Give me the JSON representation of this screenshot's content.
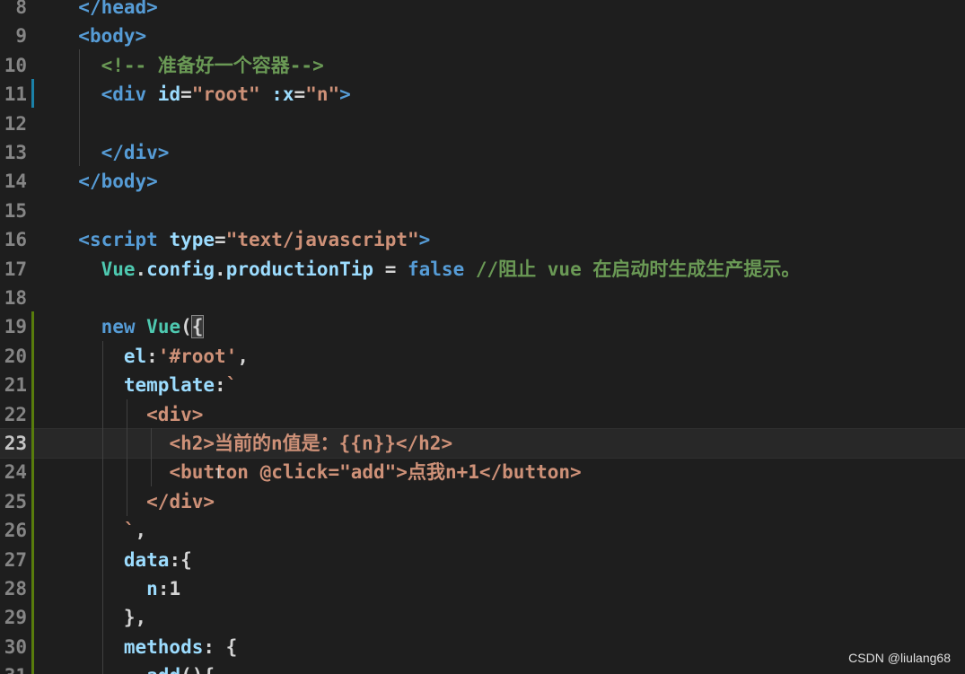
{
  "editor": {
    "language": "html",
    "current_line": "23",
    "lines": [
      {
        "n": "8",
        "parts": [
          {
            "t": "  ",
            "c": "punct"
          },
          {
            "t": "</head>",
            "c": "tag"
          }
        ]
      },
      {
        "n": "9",
        "parts": [
          {
            "t": "  ",
            "c": "punct"
          },
          {
            "t": "<body>",
            "c": "tag"
          }
        ]
      },
      {
        "n": "10",
        "parts": [
          {
            "t": "    ",
            "c": "punct"
          },
          {
            "t": "<!-- 准备好一个容器-->",
            "c": "cmt"
          }
        ]
      },
      {
        "n": "11",
        "parts": [
          {
            "t": "    ",
            "c": "punct"
          },
          {
            "t": "<div",
            "c": "tag"
          },
          {
            "t": " id",
            "c": "attr"
          },
          {
            "t": "=",
            "c": "punct"
          },
          {
            "t": "\"root\"",
            "c": "str"
          },
          {
            "t": " :x",
            "c": "attr"
          },
          {
            "t": "=",
            "c": "punct"
          },
          {
            "t": "\"n\"",
            "c": "str"
          },
          {
            "t": ">",
            "c": "tag"
          }
        ]
      },
      {
        "n": "12",
        "parts": []
      },
      {
        "n": "13",
        "parts": [
          {
            "t": "    ",
            "c": "punct"
          },
          {
            "t": "</div>",
            "c": "tag"
          }
        ]
      },
      {
        "n": "14",
        "parts": [
          {
            "t": "  ",
            "c": "punct"
          },
          {
            "t": "</body>",
            "c": "tag"
          }
        ]
      },
      {
        "n": "15",
        "parts": []
      },
      {
        "n": "16",
        "parts": [
          {
            "t": "  ",
            "c": "punct"
          },
          {
            "t": "<script",
            "c": "tag"
          },
          {
            "t": " type",
            "c": "attr"
          },
          {
            "t": "=",
            "c": "punct"
          },
          {
            "t": "\"text/javascript\"",
            "c": "str"
          },
          {
            "t": ">",
            "c": "tag"
          }
        ]
      },
      {
        "n": "17",
        "parts": [
          {
            "t": "    ",
            "c": "punct"
          },
          {
            "t": "Vue",
            "c": "cls"
          },
          {
            "t": ".",
            "c": "punct"
          },
          {
            "t": "config",
            "c": "prop"
          },
          {
            "t": ".",
            "c": "punct"
          },
          {
            "t": "productionTip",
            "c": "prop"
          },
          {
            "t": " = ",
            "c": "punct"
          },
          {
            "t": "false",
            "c": "kw"
          },
          {
            "t": " //阻止 vue 在启动时生成生产提示。",
            "c": "cmt"
          }
        ]
      },
      {
        "n": "18",
        "parts": []
      },
      {
        "n": "19",
        "parts": [
          {
            "t": "    ",
            "c": "punct"
          },
          {
            "t": "new",
            "c": "kw"
          },
          {
            "t": " ",
            "c": "punct"
          },
          {
            "t": "Vue",
            "c": "cls"
          },
          {
            "t": "(",
            "c": "punct"
          },
          {
            "t": "{",
            "c": "punct",
            "hl": true
          }
        ]
      },
      {
        "n": "20",
        "parts": [
          {
            "t": "      ",
            "c": "punct"
          },
          {
            "t": "el",
            "c": "prop"
          },
          {
            "t": ":",
            "c": "punct"
          },
          {
            "t": "'#root'",
            "c": "str"
          },
          {
            "t": ",",
            "c": "punct"
          }
        ]
      },
      {
        "n": "21",
        "parts": [
          {
            "t": "      ",
            "c": "punct"
          },
          {
            "t": "template",
            "c": "prop"
          },
          {
            "t": ":",
            "c": "punct"
          },
          {
            "t": "`",
            "c": "tpl"
          }
        ]
      },
      {
        "n": "22",
        "parts": [
          {
            "t": "        ",
            "c": "punct"
          },
          {
            "t": "<div>",
            "c": "tpl"
          }
        ]
      },
      {
        "n": "23",
        "parts": [
          {
            "t": "          ",
            "c": "punct"
          },
          {
            "t": "<h2>当前的n值是：{{n}}</h2>",
            "c": "tpl"
          }
        ]
      },
      {
        "n": "24",
        "parts": [
          {
            "t": "          ",
            "c": "punct"
          },
          {
            "t": "<button @click=\"add\">点我n+1</button>",
            "c": "tpl"
          }
        ]
      },
      {
        "n": "25",
        "parts": [
          {
            "t": "        ",
            "c": "punct"
          },
          {
            "t": "</div>",
            "c": "tpl"
          }
        ]
      },
      {
        "n": "26",
        "parts": [
          {
            "t": "      ",
            "c": "punct"
          },
          {
            "t": "`",
            "c": "tpl"
          },
          {
            "t": ",",
            "c": "punct"
          }
        ]
      },
      {
        "n": "27",
        "parts": [
          {
            "t": "      ",
            "c": "punct"
          },
          {
            "t": "data",
            "c": "prop"
          },
          {
            "t": ":{",
            "c": "punct"
          }
        ]
      },
      {
        "n": "28",
        "parts": [
          {
            "t": "        ",
            "c": "punct"
          },
          {
            "t": "n",
            "c": "prop"
          },
          {
            "t": ":1",
            "c": "punct"
          }
        ]
      },
      {
        "n": "29",
        "parts": [
          {
            "t": "      ",
            "c": "punct"
          },
          {
            "t": "},",
            "c": "punct"
          }
        ]
      },
      {
        "n": "30",
        "parts": [
          {
            "t": "      ",
            "c": "punct"
          },
          {
            "t": "methods",
            "c": "prop"
          },
          {
            "t": ": {",
            "c": "punct"
          }
        ]
      },
      {
        "n": "31",
        "parts": [
          {
            "t": "        ",
            "c": "punct"
          },
          {
            "t": "add",
            "c": "prop"
          },
          {
            "t": "(){",
            "c": "punct"
          }
        ]
      }
    ]
  },
  "cursor_glyph": "I",
  "watermark": "CSDN @liulang68",
  "colors": {
    "background": "#1e1e1e",
    "tag": "#569cd6",
    "attr": "#9cdcfe",
    "string": "#ce9178",
    "comment": "#6a9955",
    "class": "#4ec9b0",
    "git_modified": "#1b81a8",
    "git_added": "#587c0c"
  }
}
